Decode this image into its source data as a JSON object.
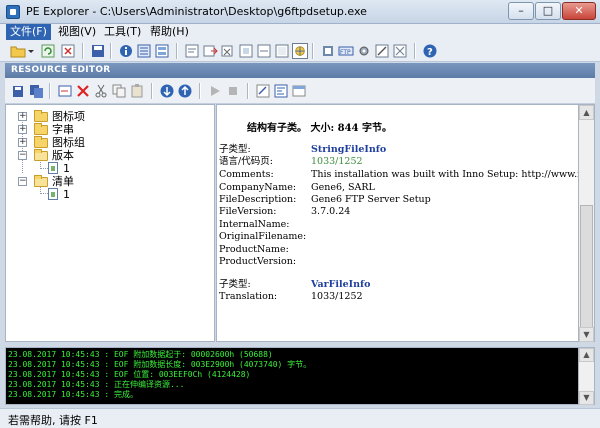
{
  "window": {
    "title": "PE Explorer - C:\\Users\\Administrator\\Desktop\\g6ftpdsetup.exe",
    "minimize": "–",
    "maximize": "□",
    "close": "✕"
  },
  "menu": [
    "文件(F)",
    "视图(V)",
    "工具(T)",
    "帮助(H)"
  ],
  "panel_title": "RESOURCE EDITOR",
  "tree": {
    "nodes": [
      {
        "label": "图标项",
        "expander": "+"
      },
      {
        "label": "字串",
        "expander": "+"
      },
      {
        "label": "图标组",
        "expander": "+"
      },
      {
        "label": "版本",
        "expander": "−"
      },
      {
        "label": "1"
      },
      {
        "label": "清单",
        "expander": "−"
      },
      {
        "label": "1"
      }
    ]
  },
  "content": {
    "heading": "结构有子类。 大小: 844 字节。",
    "rows": [
      {
        "key": "子类型:",
        "value": "StringFileInfo",
        "style": "blue"
      },
      {
        "key": "语言/代码页:",
        "value": "1033/1252",
        "style": "green"
      },
      {
        "key": "Comments:",
        "value": "This installation was built with Inno Setup: http://www.in"
      },
      {
        "key": "CompanyName:",
        "value": "Gene6, SARL"
      },
      {
        "key": "FileDescription:",
        "value": "Gene6 FTP Server Setup"
      },
      {
        "key": "FileVersion:",
        "value": "3.7.0.24"
      },
      {
        "key": "InternalName:",
        "value": ""
      },
      {
        "key": "OriginalFilename:",
        "value": ""
      },
      {
        "key": "ProductName:",
        "value": ""
      },
      {
        "key": "ProductVersion:",
        "value": ""
      },
      {
        "key": "子类型:",
        "value": "VarFileInfo",
        "style": "blue"
      },
      {
        "key": "Translation:",
        "value": "1033/1252"
      }
    ]
  },
  "log": [
    "23.08.2017 10:45:43 : EOF 附加数据起于: 00002600h  (50688)",
    "23.08.2017 10:45:43 : EOF 附加数据长度: 003E2900h  (4073740) 字节。",
    "23.08.2017 10:45:43 : EOF 位置: 003EEF0Ch  (4124428)",
    "23.08.2017 10:45:43 : 正在伸编译资源...",
    "23.08.2017 10:45:43 : 完成。"
  ],
  "status": "若需帮助, 请按 F1",
  "colors": {
    "log_text": "#3cf03c",
    "accent": "#2f64b3"
  },
  "icons": {
    "toolbar": [
      "open-icon",
      "dropdown-arrow-icon",
      "refresh-icon",
      "close-file-icon",
      "save-icon",
      "info-icon",
      "headers-icon",
      "sections-icon",
      "resources-icon",
      "disasm-icon",
      "export-icon",
      "import-icon",
      "delay-import-icon",
      "dependency-icon",
      "resource-icon",
      "unpack-icon",
      "settings-icon",
      "ftp-icon",
      "tools-icon",
      "help-icon"
    ],
    "resource_toolbar": [
      "save-resource-icon",
      "save-all-icon",
      "rename-icon",
      "delete-icon",
      "cut-icon",
      "copy-icon",
      "paste-icon",
      "prev-icon",
      "next-icon",
      "play-icon",
      "stop-icon",
      "edit-icon",
      "view-icon",
      "dialog-icon"
    ]
  }
}
